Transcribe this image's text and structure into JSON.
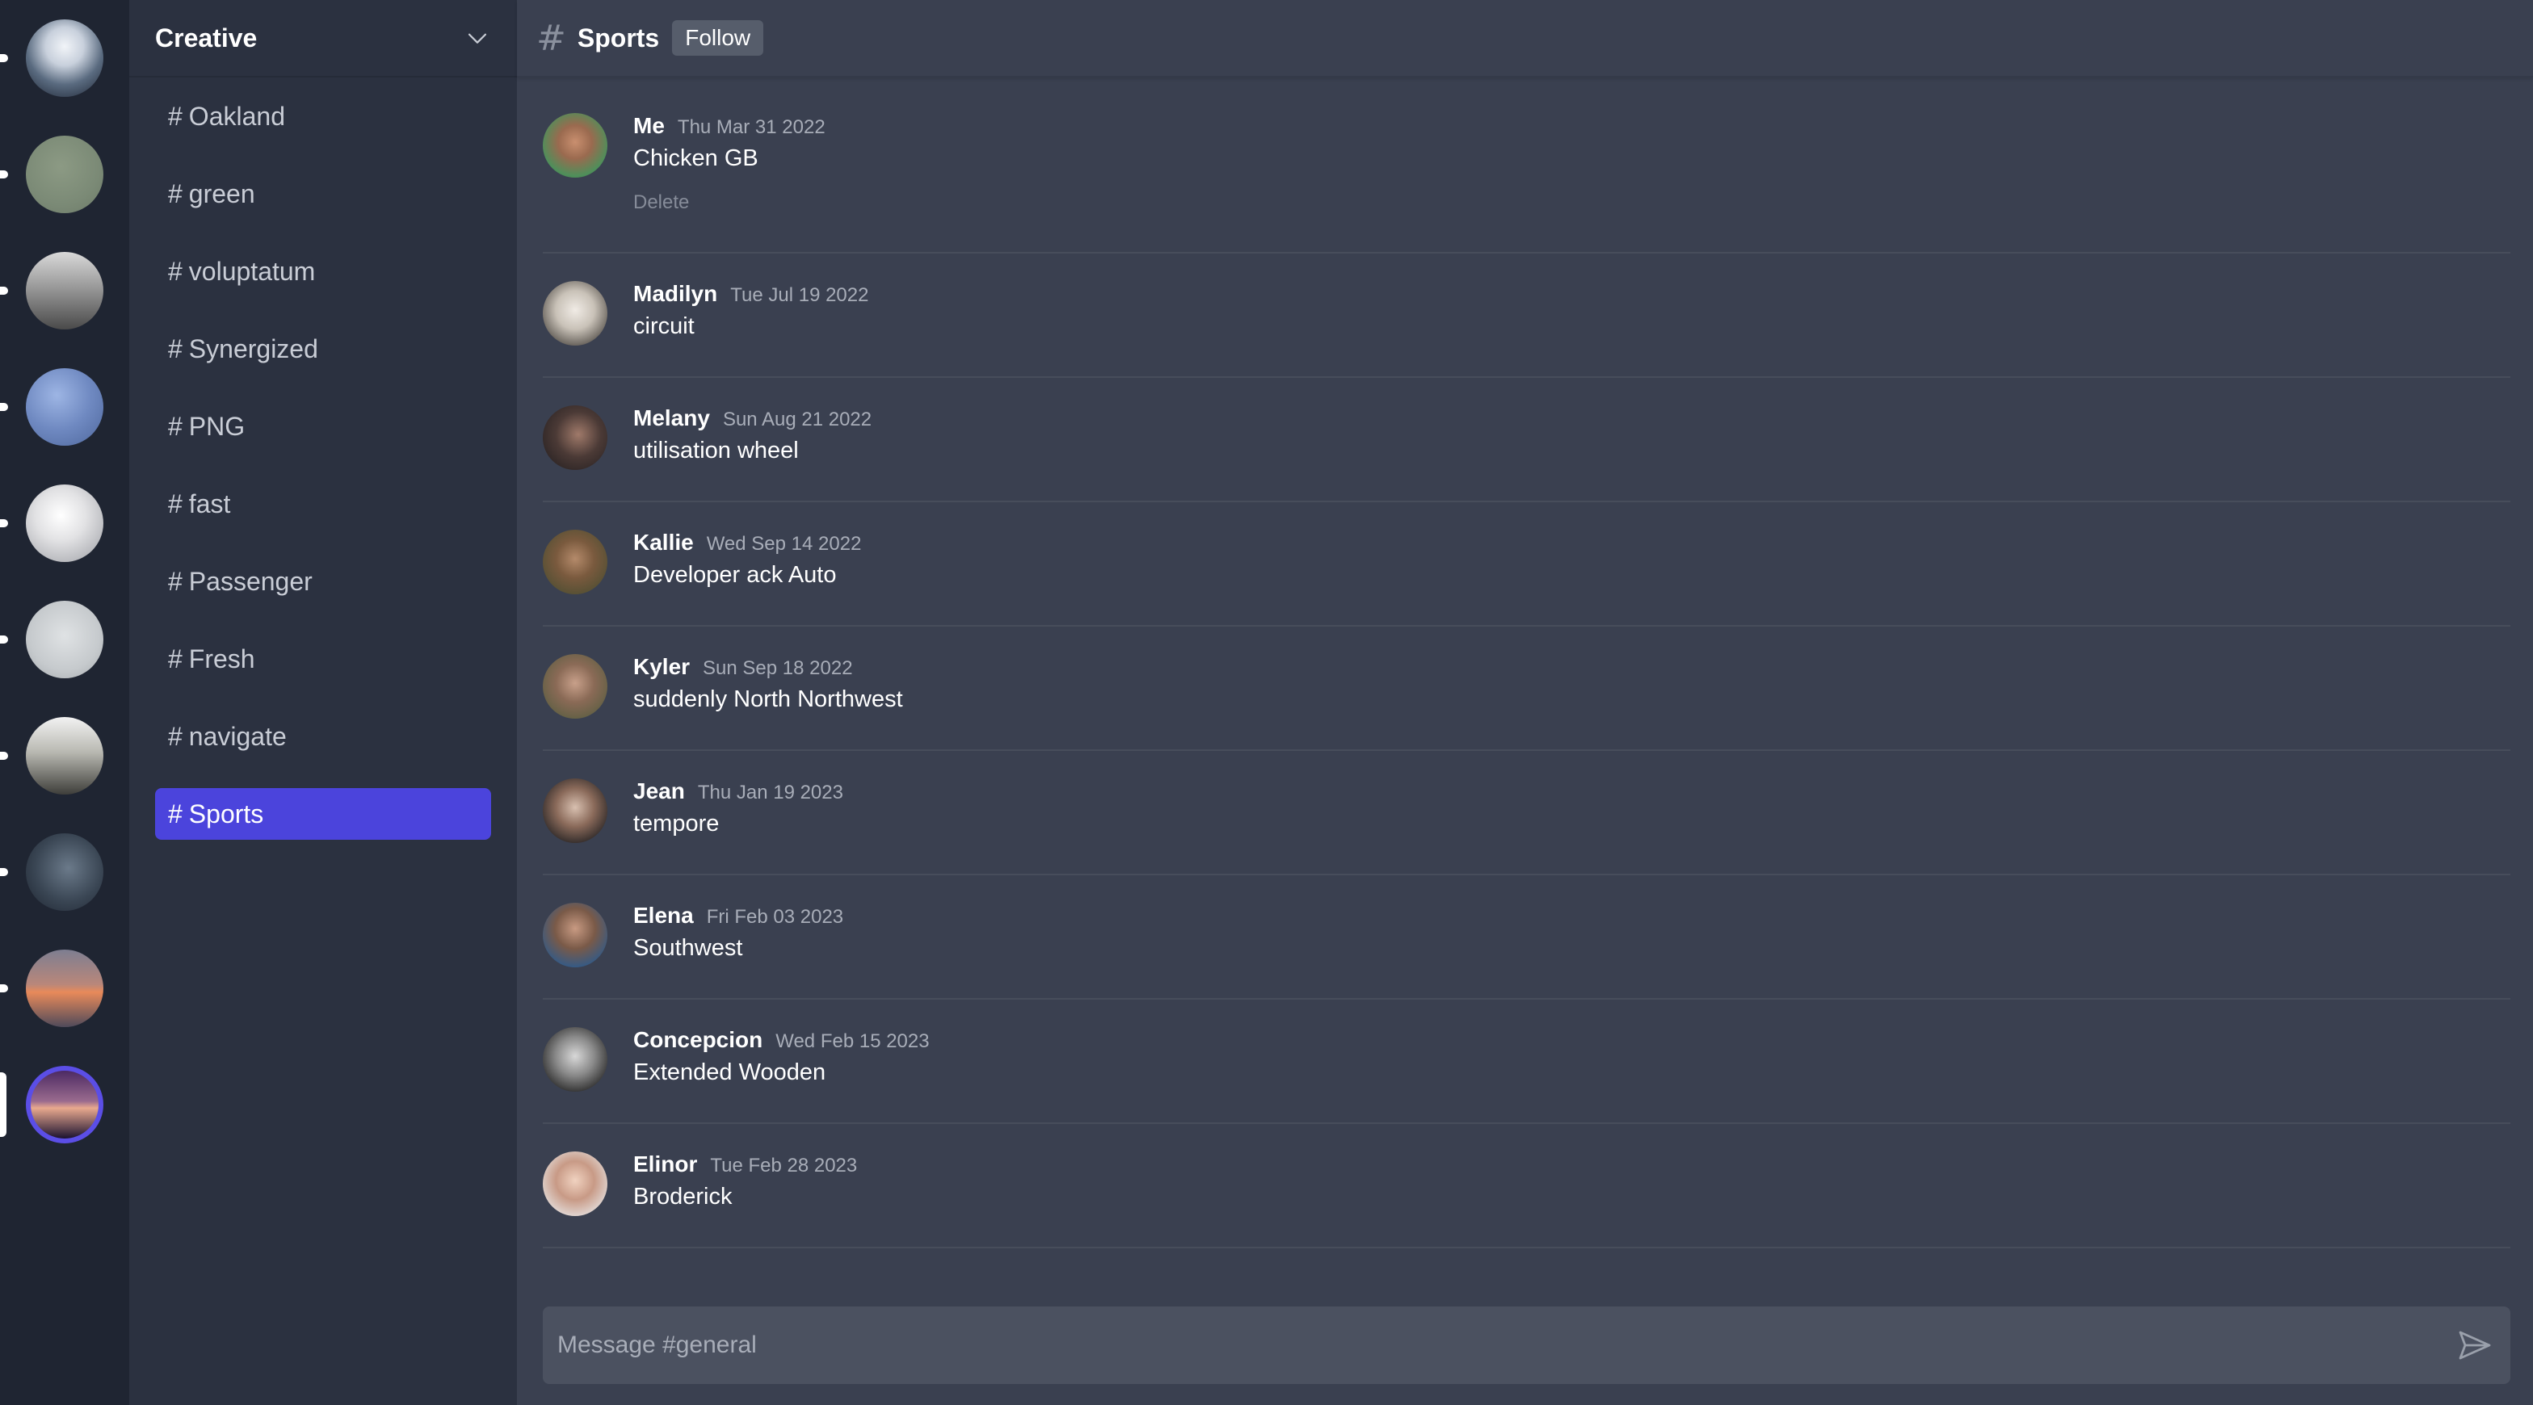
{
  "colors": {
    "rail_bg": "#1f2532",
    "sidebar_bg": "#2b3140",
    "main_bg": "#3a4050",
    "accent": "#4b44dc",
    "active_ring": "#5b4ee6"
  },
  "servers": [
    {
      "name": "server-1",
      "gradient": "radial-gradient(circle at 50% 35%, #f1f4f8 0%, #c8d0dc 30%, #5a6b80 60%, #1b2230 100%)",
      "indicator": "dot",
      "active": false
    },
    {
      "name": "server-2",
      "gradient": "radial-gradient(circle at 45% 40%, #8c9a84 0%, #7b8a76 60%, #6c7a68 100%)",
      "indicator": "dot",
      "active": false
    },
    {
      "name": "server-3",
      "gradient": "linear-gradient(180deg, #d9d9d9 0%, #9a9a9a 45%, #4a4a4a 100%)",
      "indicator": "dot",
      "active": false
    },
    {
      "name": "server-4",
      "gradient": "radial-gradient(circle at 40% 35%, #9db5e4 0%, #6f89c1 50%, #4e679c 100%)",
      "indicator": "dot",
      "active": false
    },
    {
      "name": "server-5",
      "gradient": "radial-gradient(circle at 45% 40%, #ffffff 0%, #e2e2e4 40%, #9a9ca2 100%)",
      "indicator": "dot",
      "active": false
    },
    {
      "name": "server-6",
      "gradient": "radial-gradient(circle at 50% 45%, #dfe2e4 0%, #c6cacd 60%, #a5aaae 100%)",
      "indicator": "dot",
      "active": false
    },
    {
      "name": "server-7",
      "gradient": "linear-gradient(180deg, #f2f2f2 0%, #b9b9b2 45%, #3e3e3a 100%)",
      "indicator": "dot",
      "active": false
    },
    {
      "name": "server-8",
      "gradient": "radial-gradient(circle at 55% 45%, #6b7a8a 0%, #3a4654 55%, #1d2430 100%)",
      "indicator": "dot",
      "active": false
    },
    {
      "name": "server-9",
      "gradient": "linear-gradient(180deg, #7d7e91 0%, #b9877a 45%, #e88a5a 55%, #4f4a5a 100%)",
      "indicator": "dot",
      "active": false
    },
    {
      "name": "server-10",
      "gradient": "linear-gradient(180deg, #4c2a63 0%, #9a6b8e 45%, #e9a98e 55%, #1b1230 100%)",
      "indicator": "bar",
      "active": true
    }
  ],
  "workspace": {
    "name": "Creative"
  },
  "channels": [
    {
      "hash": "#",
      "label": "Oakland",
      "selected": false
    },
    {
      "hash": "#",
      "label": "green",
      "selected": false
    },
    {
      "hash": "#",
      "label": "voluptatum",
      "selected": false
    },
    {
      "hash": "#",
      "label": "Synergized",
      "selected": false
    },
    {
      "hash": "#",
      "label": "PNG",
      "selected": false
    },
    {
      "hash": "#",
      "label": "fast",
      "selected": false
    },
    {
      "hash": "#",
      "label": "Passenger",
      "selected": false
    },
    {
      "hash": "#",
      "label": "Fresh",
      "selected": false
    },
    {
      "hash": "#",
      "label": "navigate",
      "selected": false
    },
    {
      "hash": "#",
      "label": "Sports",
      "selected": true
    }
  ],
  "header": {
    "hash": "#",
    "title": "Sports",
    "follow_label": "Follow"
  },
  "messages": [
    {
      "author": "Me",
      "date": "Thu Mar 31 2022",
      "text": "Chicken GB",
      "delete_label": "Delete",
      "avatar_gradient": "radial-gradient(circle at 50% 45%, #c98f6f 0%, #9a6a4f 35%, #4f8f5a 70%, #3b6b44 100%)"
    },
    {
      "author": "Madilyn",
      "date": "Tue Jul 19 2022",
      "text": "circuit",
      "avatar_gradient": "radial-gradient(circle at 50% 45%, #f0ebe5 0%, #c9c2b8 40%, #5a554f 80%, #2a2622 100%)"
    },
    {
      "author": "Melany",
      "date": "Sun Aug 21 2022",
      "text": "utilisation wheel",
      "avatar_gradient": "radial-gradient(circle at 55% 45%, #a07a6a 0%, #4b3a36 45%, #1d1a1c 100%)"
    },
    {
      "author": "Kallie",
      "date": "Wed Sep 14 2022",
      "text": "Developer ack Auto",
      "avatar_gradient": "radial-gradient(circle at 50% 45%, #b48a6a 0%, #7a5a3e 40%, #3f4a2e 100%)"
    },
    {
      "author": "Kyler",
      "date": "Sun Sep 18 2022",
      "text": "suddenly North Northwest",
      "avatar_gradient": "radial-gradient(circle at 50% 45%, #c8a08a 0%, #8a6a56 40%, #4a5a3a 100%)"
    },
    {
      "author": "Jean",
      "date": "Thu Jan 19 2023",
      "text": "tempore",
      "avatar_gradient": "radial-gradient(circle at 50% 45%, #d8c0b0 0%, #8a6a5a 40%, #2a2626 80%, #c8ccd0 100%)"
    },
    {
      "author": "Elena",
      "date": "Fri Feb 03 2023",
      "text": "Southwest",
      "avatar_gradient": "radial-gradient(circle at 50% 40%, #c89a82 0%, #7a5a48 40%, #2f5a8a 80%, #3a6a4a 100%)"
    },
    {
      "author": "Concepcion",
      "date": "Wed Feb 15 2023",
      "text": "Extended Wooden",
      "avatar_gradient": "radial-gradient(circle at 50% 45%, #d8d8d8 0%, #8a8a8a 40%, #2a2a2a 80%, #bdbdbd 100%)"
    },
    {
      "author": "Elinor",
      "date": "Tue Feb 28 2023",
      "text": "Broderick",
      "avatar_gradient": "radial-gradient(circle at 50% 45%, #f0d2c0 0%, #c89a86 40%, #e8e8e8 85%, #ffffff 100%)"
    }
  ],
  "composer": {
    "placeholder": "Message #general"
  },
  "icons": {
    "chevron": "chevron-down-icon",
    "send": "send-icon",
    "hash": "hash-icon"
  }
}
